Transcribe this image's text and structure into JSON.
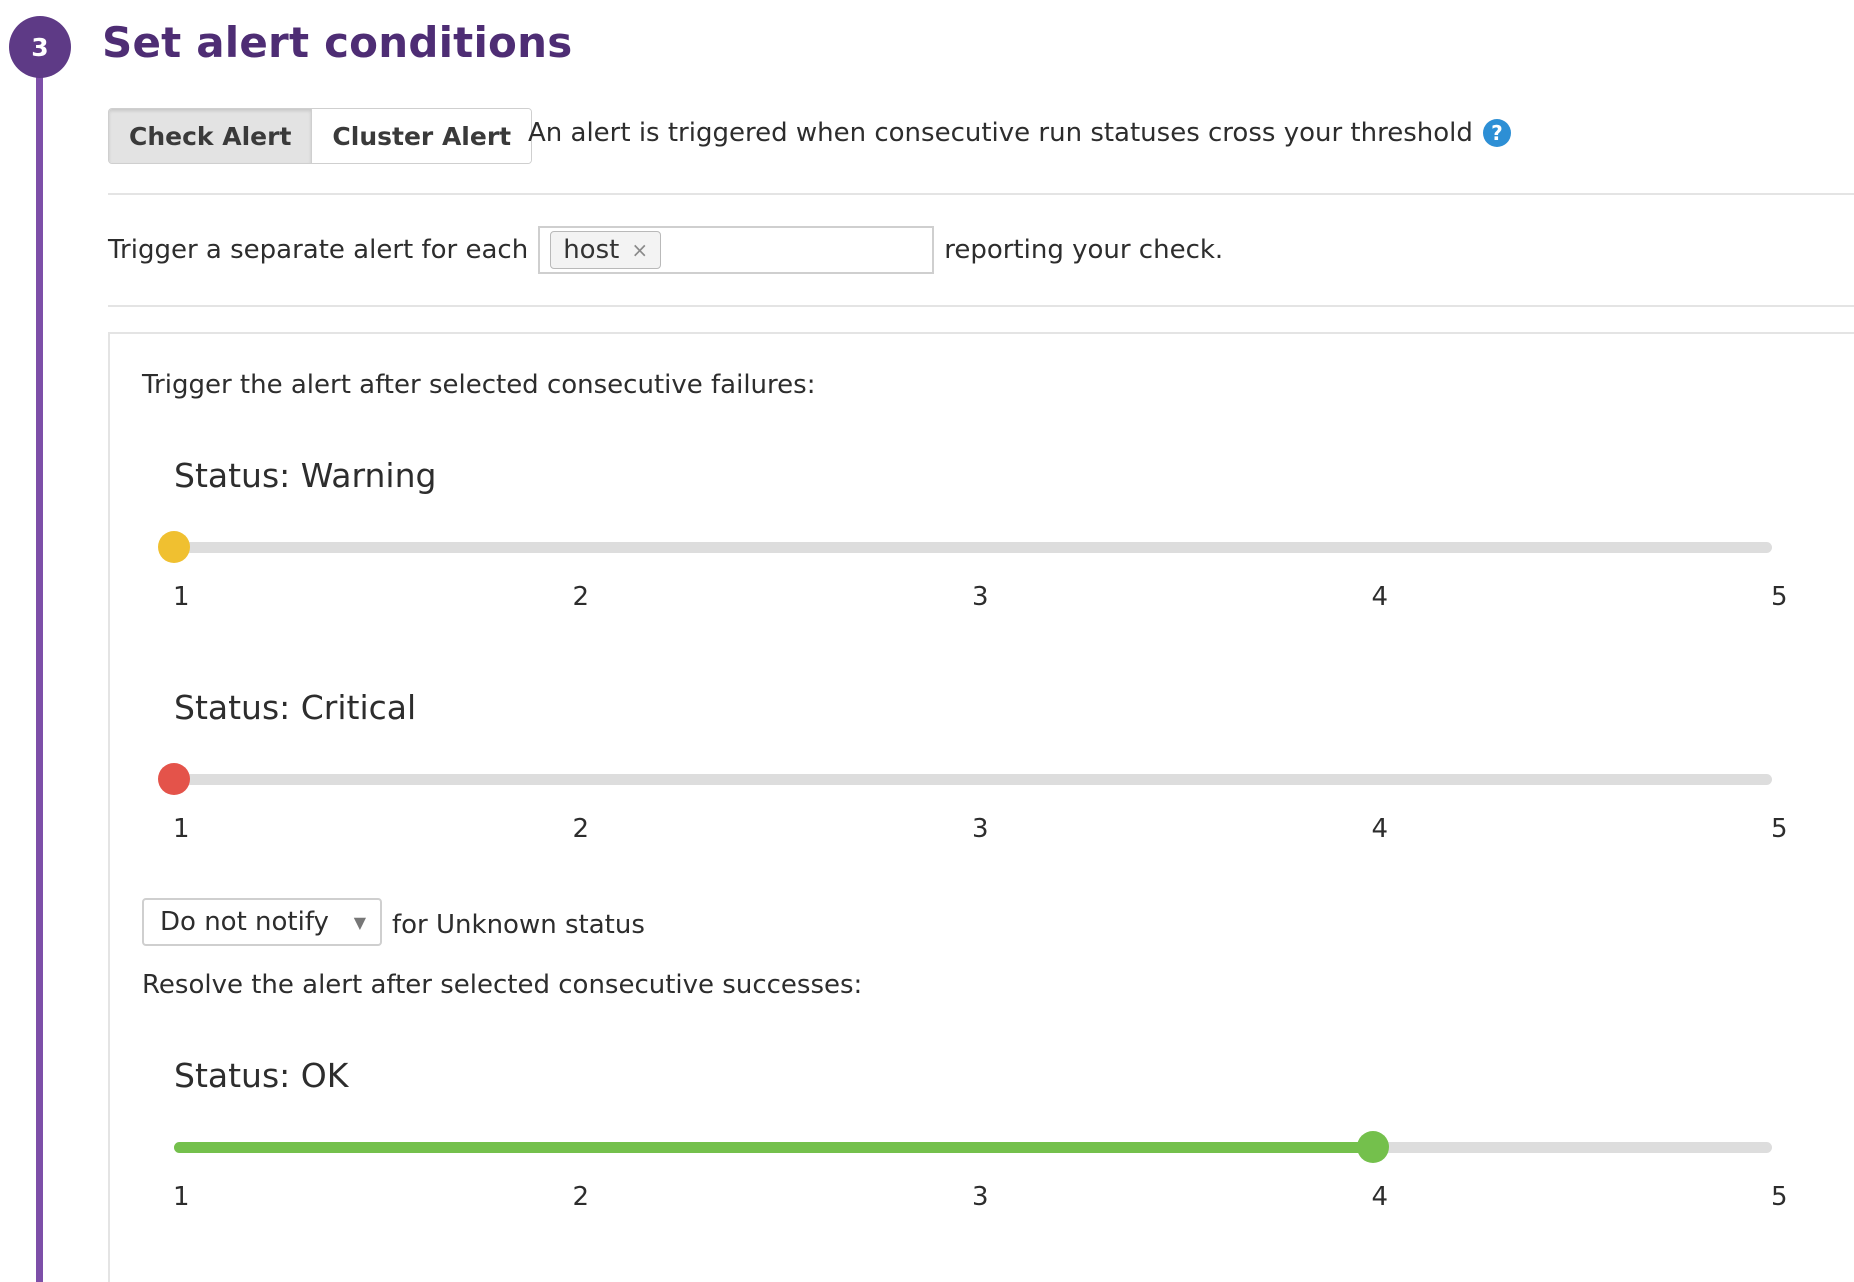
{
  "step": {
    "number": "3",
    "title": "Set alert conditions"
  },
  "alert_type": {
    "options": [
      "Check Alert",
      "Cluster Alert"
    ],
    "selected": "Check Alert",
    "description": "An alert is triggered when consecutive run statuses cross your threshold",
    "help_icon": "?"
  },
  "grouping": {
    "prefix": "Trigger a separate alert for each",
    "tags": [
      "host"
    ],
    "remove_glyph": "×",
    "suffix": "reporting your check."
  },
  "failures": {
    "label": "Trigger the alert after selected consecutive failures:",
    "sliders": [
      {
        "title": "Status: Warning",
        "value": 1,
        "min": 1,
        "max": 5,
        "color": "#f0c030",
        "ticks": [
          "1",
          "2",
          "3",
          "4",
          "5"
        ]
      },
      {
        "title": "Status: Critical",
        "value": 1,
        "min": 1,
        "max": 5,
        "color": "#e4534a",
        "ticks": [
          "1",
          "2",
          "3",
          "4",
          "5"
        ]
      }
    ]
  },
  "unknown": {
    "selected": "Do not notify",
    "suffix": "for Unknown status"
  },
  "successes": {
    "label": "Resolve the alert after selected consecutive successes:",
    "sliders": [
      {
        "title": "Status: OK",
        "value": 4,
        "min": 1,
        "max": 5,
        "color": "#74c04c",
        "ticks": [
          "1",
          "2",
          "3",
          "4",
          "5"
        ]
      }
    ]
  },
  "colors": {
    "step_accent": "#5e3a86",
    "rail": "#7d4fa8",
    "help": "#2d8fd5"
  }
}
